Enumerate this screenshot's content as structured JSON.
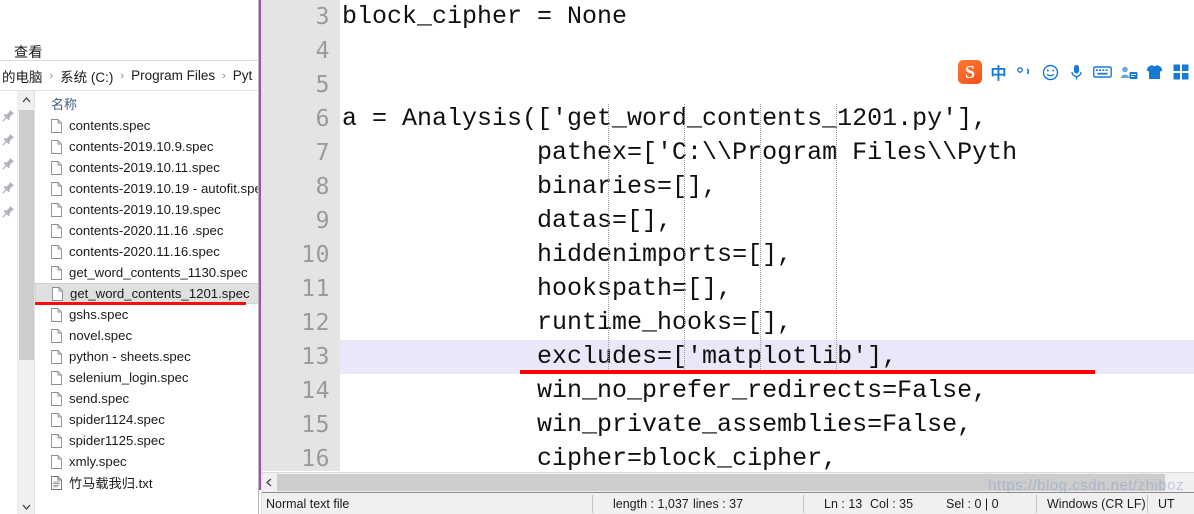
{
  "explorer": {
    "tab_label": "查看",
    "breadcrumb": [
      "的电脑",
      "系统 (C:)",
      "Program Files",
      "Pyt"
    ],
    "breadcrumb_separator": "›",
    "column_header": "名称",
    "scroll_up_icon": "chevron-up-icon",
    "scroll_down_icon": "chevron-down-icon",
    "pin_icon": "pin-icon",
    "pin_count": 5,
    "selected_file": "get_word_contents_1201.spec",
    "files": [
      {
        "name": "contents.spec",
        "icon": "file-icon"
      },
      {
        "name": "contents-2019.10.9.spec",
        "icon": "file-icon"
      },
      {
        "name": "contents-2019.10.11.spec",
        "icon": "file-icon"
      },
      {
        "name": "contents-2019.10.19 - autofit.spe",
        "icon": "file-icon"
      },
      {
        "name": "contents-2019.10.19.spec",
        "icon": "file-icon"
      },
      {
        "name": "contents-2020.11.16 .spec",
        "icon": "file-icon"
      },
      {
        "name": "contents-2020.11.16.spec",
        "icon": "file-icon"
      },
      {
        "name": "get_word_contents_1130.spec",
        "icon": "file-icon"
      },
      {
        "name": "get_word_contents_1201.spec",
        "icon": "file-icon"
      },
      {
        "name": "gshs.spec",
        "icon": "file-icon"
      },
      {
        "name": "novel.spec",
        "icon": "file-icon"
      },
      {
        "name": "python - sheets.spec",
        "icon": "file-icon"
      },
      {
        "name": "selenium_login.spec",
        "icon": "file-icon"
      },
      {
        "name": "send.spec",
        "icon": "file-icon"
      },
      {
        "name": "spider1124.spec",
        "icon": "file-icon"
      },
      {
        "name": "spider1125.spec",
        "icon": "file-icon"
      },
      {
        "name": "xmly.spec",
        "icon": "file-icon"
      },
      {
        "name": "竹马载我归.txt",
        "icon": "text-file-icon"
      }
    ],
    "annotation_color": "#fa0c0c"
  },
  "editor": {
    "current_line_number": 13,
    "current_line_bg": "#e8e8f8",
    "annotation_color": "#ff0000",
    "lines": [
      {
        "num": "3",
        "text": "block_cipher = None"
      },
      {
        "num": "4",
        "text": ""
      },
      {
        "num": "5",
        "text": ""
      },
      {
        "num": "6",
        "text": "a = Analysis(['get_word_contents_1201.py'],"
      },
      {
        "num": "7",
        "text": "             pathex=['C:\\\\Program Files\\\\Pyth"
      },
      {
        "num": "8",
        "text": "             binaries=[],"
      },
      {
        "num": "9",
        "text": "             datas=[],"
      },
      {
        "num": "10",
        "text": "             hiddenimports=[],"
      },
      {
        "num": "11",
        "text": "             hookspath=[],"
      },
      {
        "num": "12",
        "text": "             runtime_hooks=[],"
      },
      {
        "num": "13",
        "text": "             excludes=['matplotlib'],"
      },
      {
        "num": "14",
        "text": "             win_no_prefer_redirects=False,"
      },
      {
        "num": "15",
        "text": "             win_private_assemblies=False,"
      },
      {
        "num": "16",
        "text": "             cipher=block_cipher,"
      }
    ],
    "hscroll_left_icon": "chevron-left-icon"
  },
  "statusbar": {
    "doc_type": "Normal text file",
    "length": "length : 1,037",
    "lines": "lines : 37",
    "ln": "Ln : 13",
    "col": "Col : 35",
    "sel": "Sel : 0 | 0",
    "eol": "Windows (CR LF)",
    "encoding": "UT"
  },
  "ime": {
    "logo_label": "S",
    "buttons": [
      {
        "name": "chinese-mode-icon",
        "label": "中"
      },
      {
        "name": "punctuation-icon",
        "label": "°,"
      },
      {
        "name": "emoji-icon",
        "label": "☺"
      },
      {
        "name": "microphone-icon",
        "label": "🎤"
      },
      {
        "name": "keyboard-icon",
        "label": "⌨"
      },
      {
        "name": "user-card-icon",
        "label": "👤"
      },
      {
        "name": "skin-icon",
        "label": "👕"
      },
      {
        "name": "apps-grid-icon",
        "label": "▦"
      }
    ],
    "accent_color": "#1779d6",
    "logo_color": "#f4511e"
  },
  "watermark": {
    "text": "https://blog.csdn.net/zhiboz"
  }
}
